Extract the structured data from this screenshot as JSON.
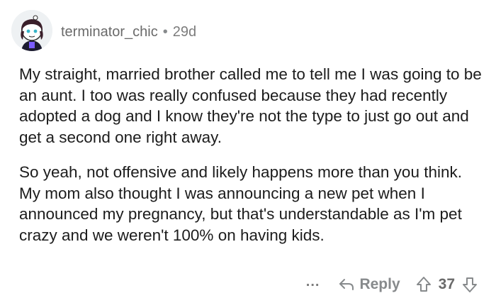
{
  "comment": {
    "author": "terminator_chic",
    "separator": "•",
    "age": "29d",
    "paragraphs": [
      "My straight, married brother called me to tell me I was going to be an aunt. I too was really confused because they had recently adopted a dog and I know they're not the type to just go out and get a second one right away.",
      "So yeah, not offensive and likely happens more than you think. My mom also thought I was announcing a new pet when I announced my pregnancy, but that's understandable as I'm pet crazy and we weren't 100% on having kids."
    ]
  },
  "actions": {
    "more": "...",
    "reply_label": "Reply",
    "score": "37"
  },
  "icons": {
    "more": "more-icon",
    "reply": "reply-arrow-icon",
    "upvote": "upvote-arrow-icon",
    "downvote": "downvote-arrow-icon"
  },
  "colors": {
    "meta": "#7c7c7c",
    "text": "#1c1c1c",
    "background": "#ffffff"
  }
}
